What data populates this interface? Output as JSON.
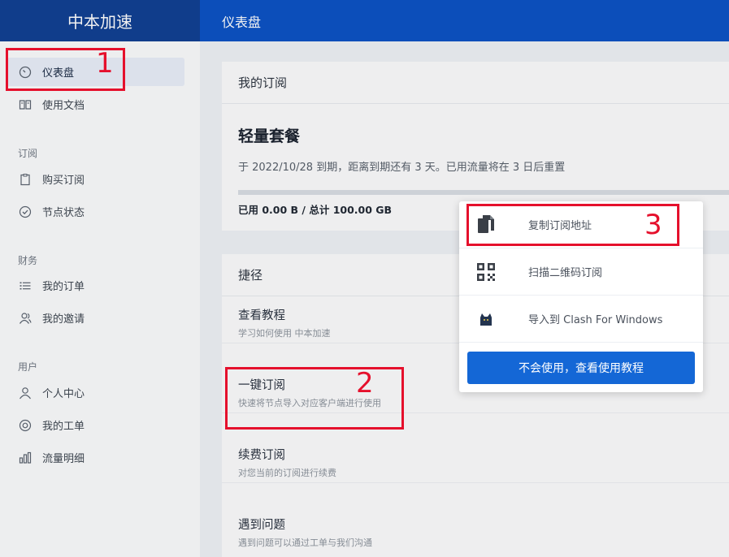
{
  "brand": "中本加速",
  "topbar_title": "仪表盘",
  "sidebar": {
    "items": [
      {
        "label": "仪表盘",
        "icon": "dashboard-icon"
      },
      {
        "label": "使用文档",
        "icon": "book-icon"
      },
      {
        "label": "购买订阅",
        "icon": "clipboard-icon"
      },
      {
        "label": "节点状态",
        "icon": "check-circle-icon"
      },
      {
        "label": "我的订单",
        "icon": "list-icon"
      },
      {
        "label": "我的邀请",
        "icon": "users-icon"
      },
      {
        "label": "个人中心",
        "icon": "user-icon"
      },
      {
        "label": "我的工单",
        "icon": "lifebuoy-icon"
      },
      {
        "label": "流量明细",
        "icon": "bar-chart-icon"
      }
    ],
    "groups": [
      "订阅",
      "财务",
      "用户"
    ]
  },
  "subscription": {
    "header": "我的订阅",
    "plan": "轻量套餐",
    "info": "于 2022/10/28 到期，距离到期还有 3 天。已用流量将在 3 日后重置",
    "usage": "已用 0.00 B / 总计 100.00 GB"
  },
  "shortcuts": {
    "header": "捷径",
    "items": [
      {
        "title": "查看教程",
        "desc": "学习如何使用 中本加速"
      },
      {
        "title": "一键订阅",
        "desc": "快速将节点导入对应客户端进行使用"
      },
      {
        "title": "续费订阅",
        "desc": "对您当前的订阅进行续费"
      },
      {
        "title": "遇到问题",
        "desc": "遇到问题可以通过工单与我们沟通"
      }
    ]
  },
  "popup": {
    "items": [
      {
        "label": "复制订阅地址",
        "icon": "copy-icon"
      },
      {
        "label": "扫描二维码订阅",
        "icon": "qr-code-icon"
      },
      {
        "label": "导入到 Clash For Windows",
        "icon": "clash-cat-icon"
      }
    ],
    "button": "不会使用，查看使用教程"
  },
  "annotations": [
    "1",
    "2",
    "3"
  ],
  "colors": {
    "brand_bg": "#114193",
    "topbar_bg": "#0d53c5",
    "button_bg": "#1467d6",
    "annotation": "#e5102c"
  }
}
